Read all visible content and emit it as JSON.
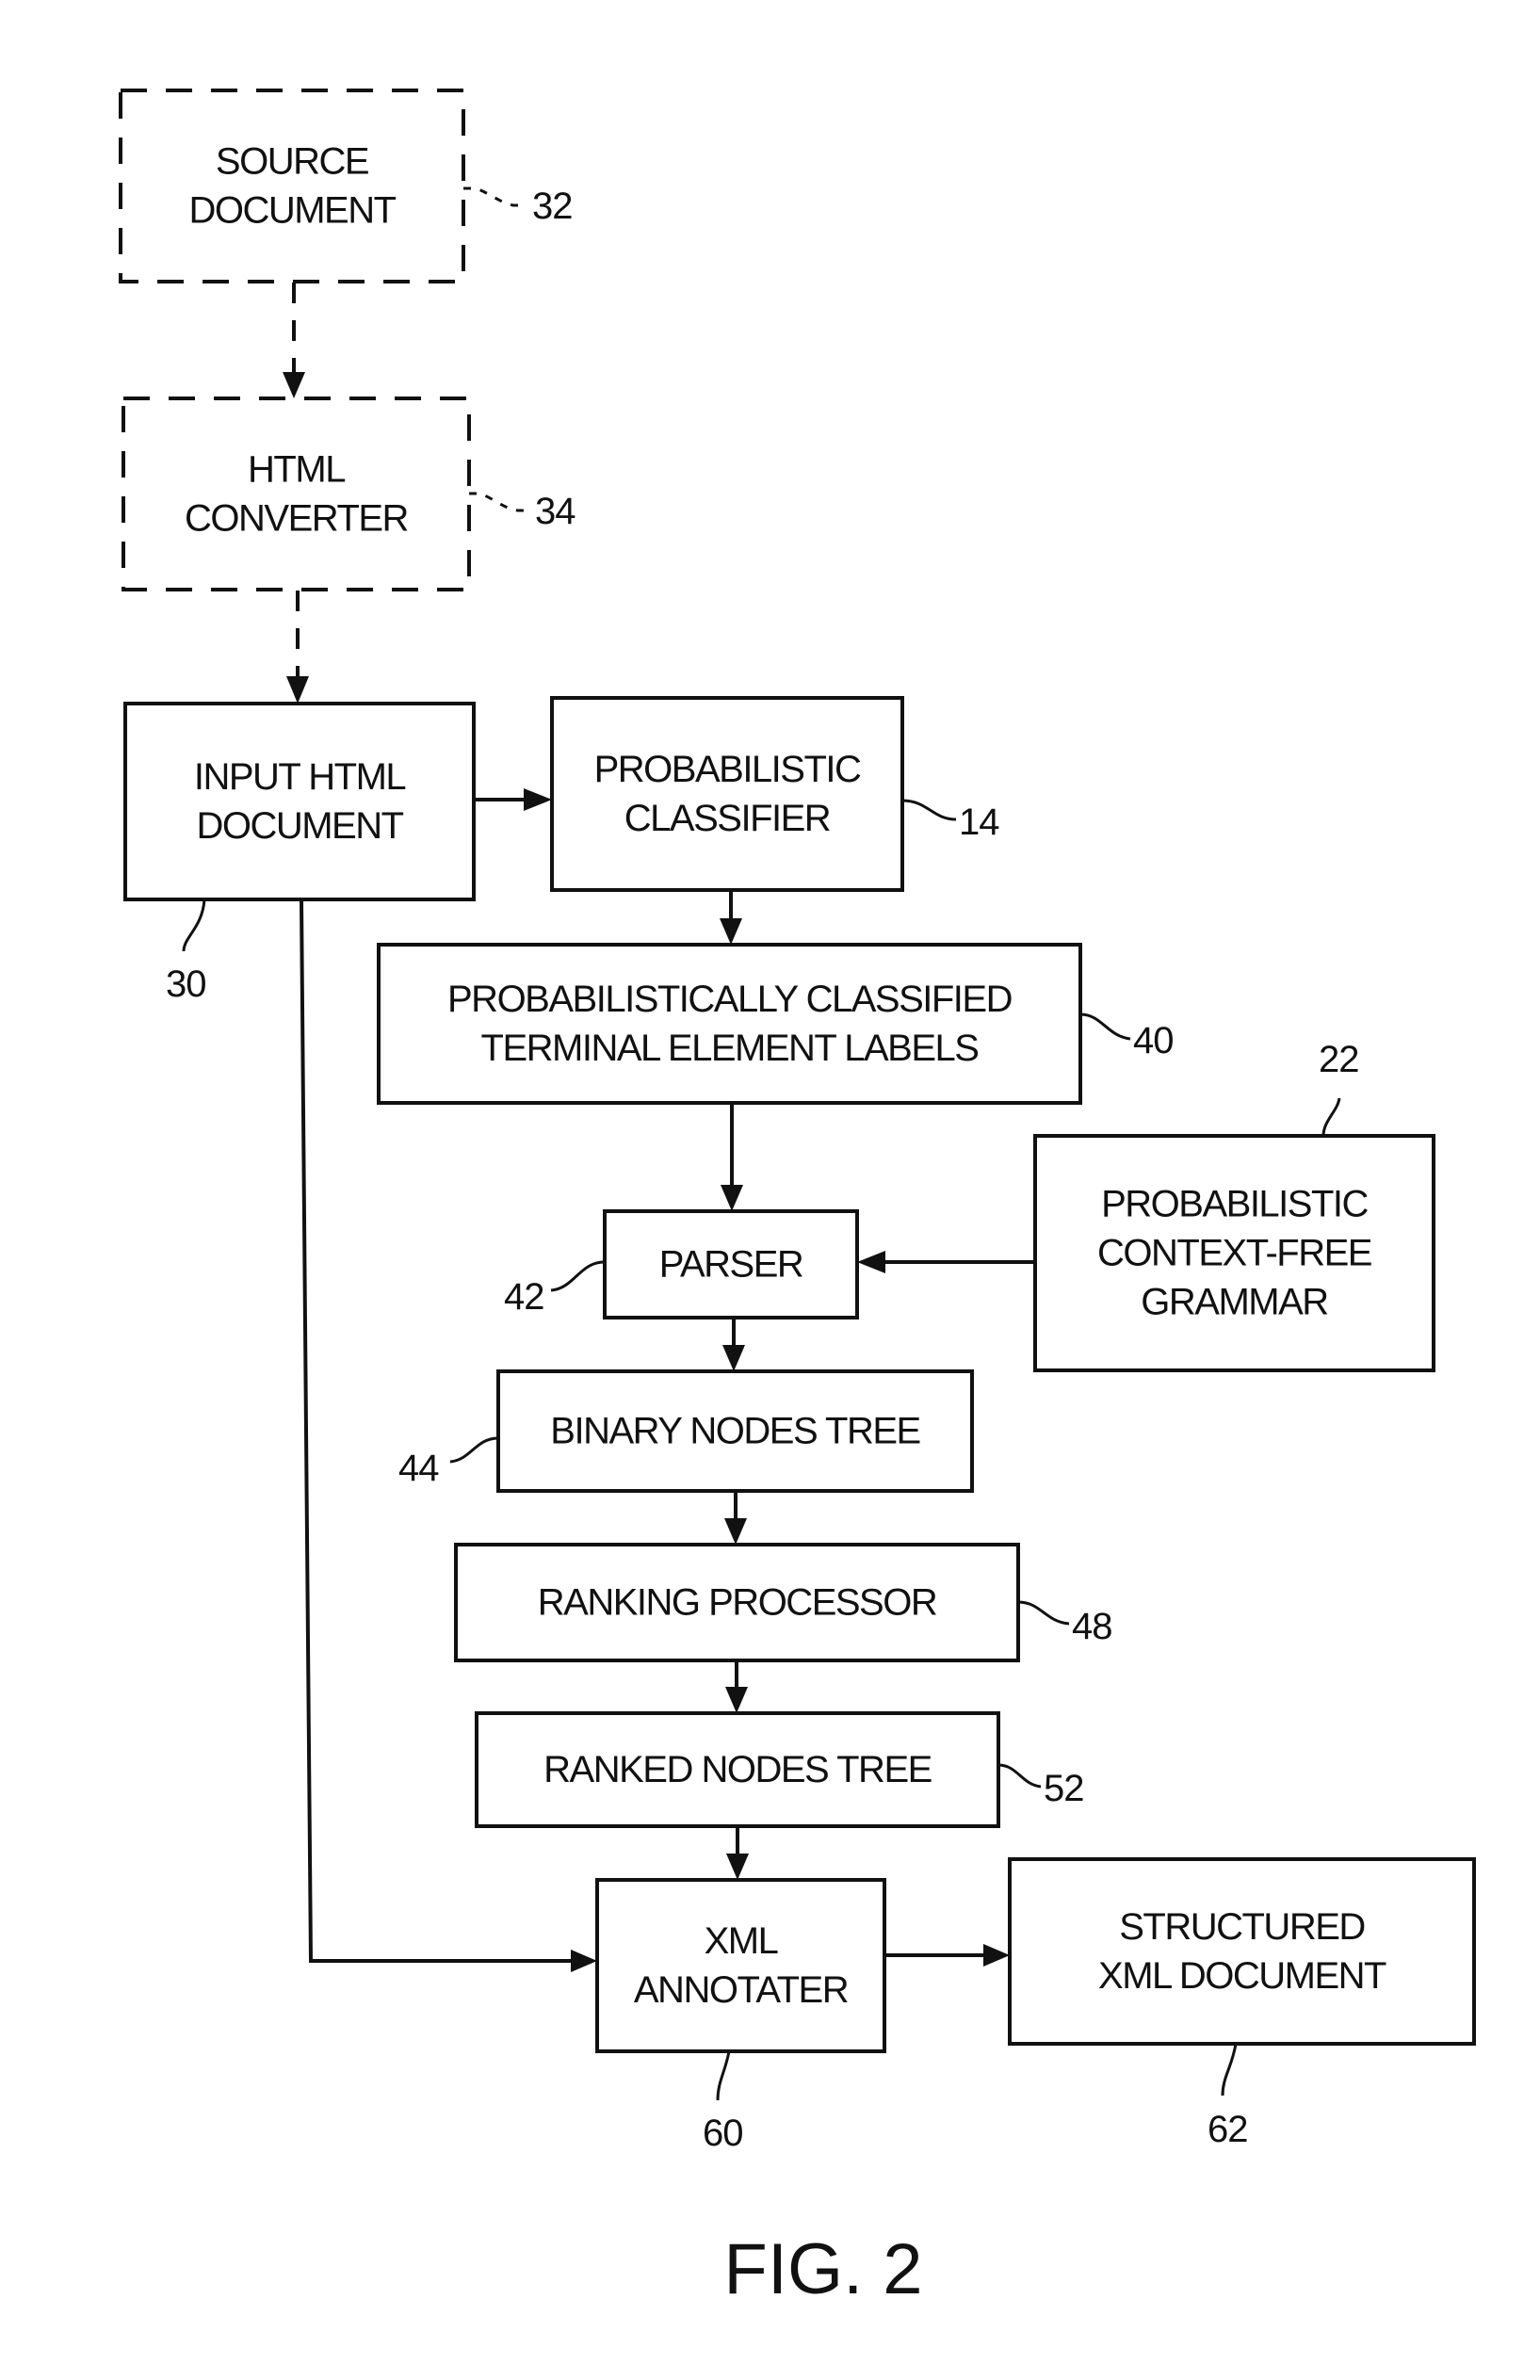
{
  "figure": {
    "caption": "FIG. 2",
    "nodes": [
      {
        "id": "source-document",
        "lines": [
          "SOURCE",
          "DOCUMENT"
        ],
        "ref": "32",
        "style": "dashed"
      },
      {
        "id": "html-converter",
        "lines": [
          "HTML",
          "CONVERTER"
        ],
        "ref": "34",
        "style": "dashed"
      },
      {
        "id": "input-html-document",
        "lines": [
          "INPUT HTML",
          "DOCUMENT"
        ],
        "ref": "30",
        "style": "solid"
      },
      {
        "id": "probabilistic-classifier",
        "lines": [
          "PROBABILISTIC",
          "CLASSIFIER"
        ],
        "ref": "14",
        "style": "solid"
      },
      {
        "id": "classified-labels",
        "lines": [
          "PROBABILISTICALLY CLASSIFIED",
          "TERMINAL ELEMENT LABELS"
        ],
        "ref": "40",
        "style": "solid"
      },
      {
        "id": "pcfg",
        "lines": [
          "PROBABILISTIC",
          "CONTEXT-FREE",
          "GRAMMAR"
        ],
        "ref": "22",
        "style": "solid"
      },
      {
        "id": "parser",
        "lines": [
          "PARSER"
        ],
        "ref": "42",
        "style": "solid"
      },
      {
        "id": "binary-nodes-tree",
        "lines": [
          "BINARY NODES TREE"
        ],
        "ref": "44",
        "style": "solid"
      },
      {
        "id": "ranking-processor",
        "lines": [
          "RANKING PROCESSOR"
        ],
        "ref": "48",
        "style": "solid"
      },
      {
        "id": "ranked-nodes-tree",
        "lines": [
          "RANKED NODES TREE"
        ],
        "ref": "52",
        "style": "solid"
      },
      {
        "id": "xml-annotater",
        "lines": [
          "XML",
          "ANNOTATER"
        ],
        "ref": "60",
        "style": "solid"
      },
      {
        "id": "structured-xml-document",
        "lines": [
          "STRUCTURED",
          "XML DOCUMENT"
        ],
        "ref": "62",
        "style": "solid"
      }
    ],
    "edges": [
      {
        "from": "source-document",
        "to": "html-converter",
        "style": "dashed"
      },
      {
        "from": "html-converter",
        "to": "input-html-document",
        "style": "dashed"
      },
      {
        "from": "input-html-document",
        "to": "probabilistic-classifier",
        "style": "solid"
      },
      {
        "from": "probabilistic-classifier",
        "to": "classified-labels",
        "style": "solid"
      },
      {
        "from": "classified-labels",
        "to": "parser",
        "style": "solid"
      },
      {
        "from": "pcfg",
        "to": "parser",
        "style": "solid"
      },
      {
        "from": "parser",
        "to": "binary-nodes-tree",
        "style": "solid"
      },
      {
        "from": "binary-nodes-tree",
        "to": "ranking-processor",
        "style": "solid"
      },
      {
        "from": "ranking-processor",
        "to": "ranked-nodes-tree",
        "style": "solid"
      },
      {
        "from": "ranked-nodes-tree",
        "to": "xml-annotater",
        "style": "solid"
      },
      {
        "from": "input-html-document",
        "to": "xml-annotater",
        "style": "solid"
      },
      {
        "from": "xml-annotater",
        "to": "structured-xml-document",
        "style": "solid"
      }
    ]
  }
}
